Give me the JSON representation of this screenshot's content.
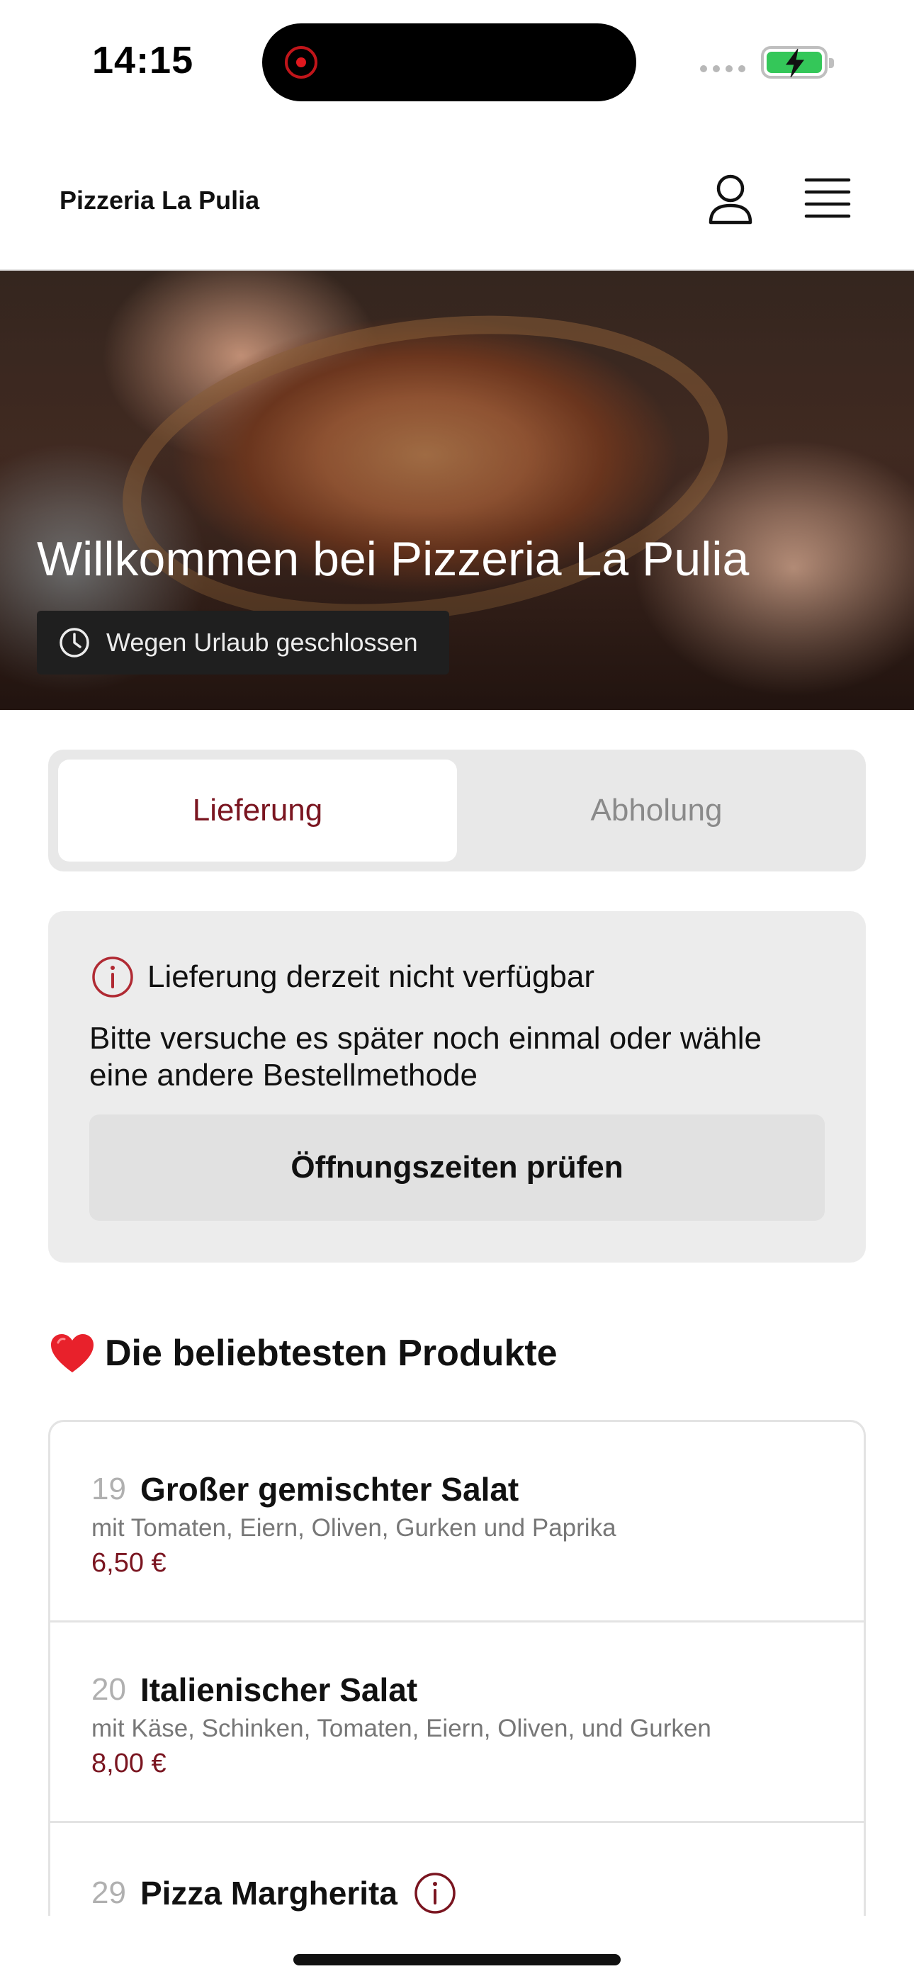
{
  "status_bar": {
    "time": "14:15",
    "recording_icon": "screen-recording-dot",
    "battery_icon": "battery-charging-icon"
  },
  "header": {
    "brand": "Pizzeria La Pulia",
    "user_icon": "user-icon",
    "menu_icon": "hamburger-menu-icon"
  },
  "hero": {
    "title": "Willkommen bei Pizzeria La Pulia",
    "status_badge": "Wegen Urlaub geschlossen",
    "status_icon": "clock-icon"
  },
  "order_modes": {
    "tabs": [
      {
        "label": "Lieferung",
        "active": true
      },
      {
        "label": "Abholung",
        "active": false
      }
    ]
  },
  "notice": {
    "icon": "info-circle-icon",
    "title": "Lieferung derzeit nicht verfügbar",
    "body": "Bitte versuche es später noch einmal oder wähle eine andere Bestellmethode",
    "button_label": "Öffnungszeiten prüfen"
  },
  "popular": {
    "title": "Die beliebtesten Produkte",
    "icon": "heart-icon",
    "items": [
      {
        "number": "19",
        "name": "Großer gemischter Salat",
        "description": "mit Tomaten, Eiern, Oliven, Gurken und Paprika",
        "price": "6,50 €"
      },
      {
        "number": "20",
        "name": "Italienischer Salat",
        "description": "mit Käse, Schinken, Tomaten, Eiern, Oliven, und Gurken",
        "price": "8,00 €"
      },
      {
        "number": "29",
        "name": "Pizza Margherita",
        "description": "",
        "price": ""
      }
    ]
  },
  "colors": {
    "accent": "#7a1520",
    "tab_track": "#e8e8e8",
    "notice_bg": "#ececec"
  }
}
